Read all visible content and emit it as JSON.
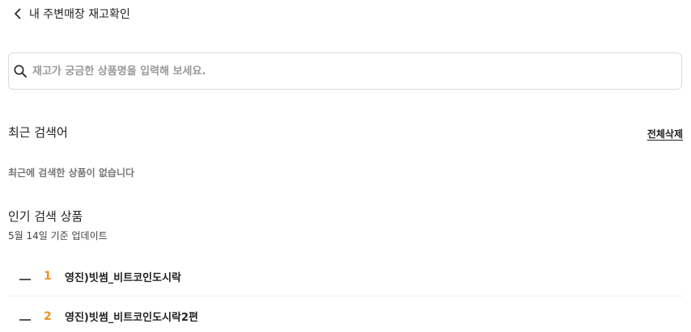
{
  "header": {
    "title": "내 주변매장 재고확인",
    "back_icon": "chevron-left-icon"
  },
  "search": {
    "placeholder": "재고가 궁금한 상품명을 입력해 보세요.",
    "value": "",
    "icon": "search-icon"
  },
  "recent": {
    "title": "최근 검색어",
    "clear_all": "전체삭제",
    "empty_text": "최근에 검색한 상품이 없습니다"
  },
  "popular": {
    "title": "인기 검색 상품",
    "subtitle": "5월 14일 기준 업데이트",
    "accent_color": "#f0901e",
    "items": [
      {
        "rank": "1",
        "trend": "no-change",
        "name": "영진)빗썸_비트코인도시락"
      },
      {
        "rank": "2",
        "trend": "no-change",
        "name": "영진)빗썸_비트코인도시락2편"
      }
    ]
  }
}
